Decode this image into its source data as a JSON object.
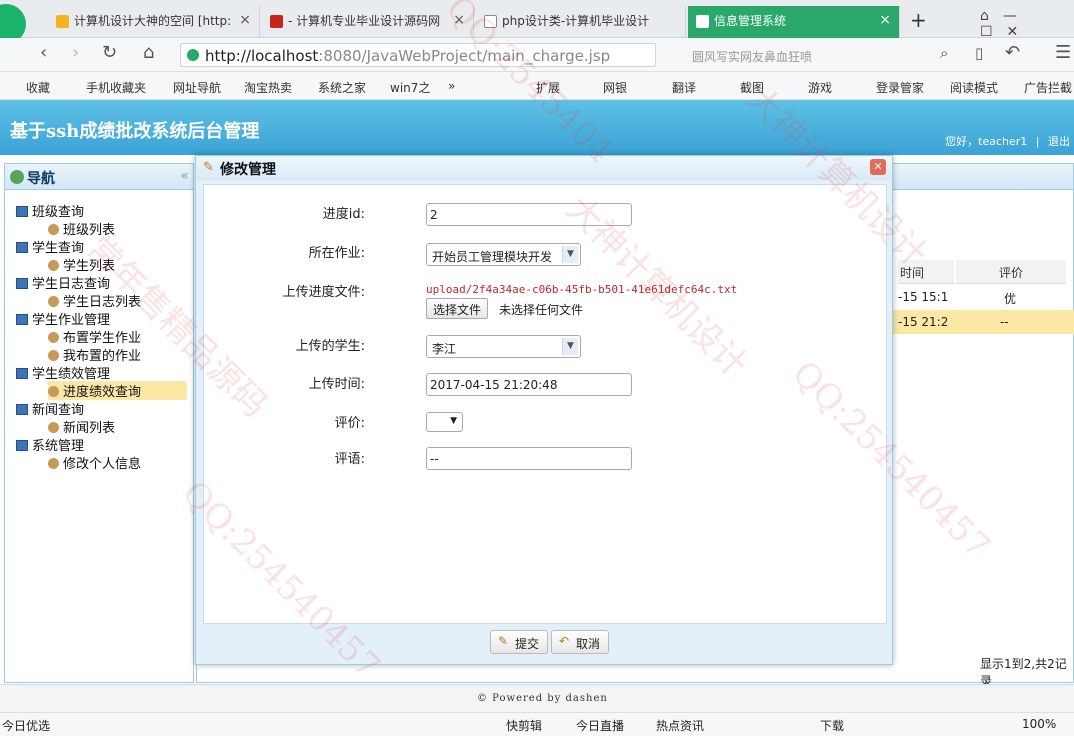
{
  "browser": {
    "tabs": [
      {
        "label": "计算机设计大神的空间 [http:"
      },
      {
        "label": "- 计算机专业毕业设计源码网"
      },
      {
        "label": "php设计类-计算机毕业设计"
      },
      {
        "label": "信息管理系统"
      }
    ],
    "new_tab": "+",
    "url_host": "http://localhost",
    "url_rest": ":8080/JavaWebProject/main_charge.jsp",
    "search_text": "圆风写实网友鼻血狂喷",
    "bookmarks": [
      "收藏",
      "手机收藏夹",
      "网址导航",
      "淘宝热卖",
      "系统之家",
      "win7之",
      "»",
      "扩展",
      "网银",
      "翻译",
      "截图",
      "游戏",
      "登录管家",
      "阅读模式",
      "广告拦截"
    ]
  },
  "app": {
    "title": "基于ssh成绩批改系统后台管理",
    "greeting": "您好，teacher1",
    "sep": "|",
    "logout": "退出",
    "footer": "© Powered by dashen",
    "paging": "显示1到2,共2记录"
  },
  "nav": {
    "title": "导航",
    "collapse": "«",
    "items": [
      {
        "label": "班级查询",
        "level": 0
      },
      {
        "label": "班级列表",
        "level": 1
      },
      {
        "label": "学生查询",
        "level": 0
      },
      {
        "label": "学生列表",
        "level": 1
      },
      {
        "label": "学生日志查询",
        "level": 0
      },
      {
        "label": "学生日志列表",
        "level": 1
      },
      {
        "label": "学生作业管理",
        "level": 0
      },
      {
        "label": "布置学生作业",
        "level": 1
      },
      {
        "label": "我布置的作业",
        "level": 1
      },
      {
        "label": "学生绩效管理",
        "level": 0
      },
      {
        "label": "进度绩效查询",
        "level": 1,
        "selected": true
      },
      {
        "label": "新闻查询",
        "level": 0
      },
      {
        "label": "新闻列表",
        "level": 1
      },
      {
        "label": "系统管理",
        "level": 0
      },
      {
        "label": "修改个人信息",
        "level": 1
      }
    ]
  },
  "grid": {
    "headers": [
      "时间",
      "评价"
    ],
    "rows": [
      [
        "-15 15:1",
        "优"
      ],
      [
        "-15 21:2",
        "--"
      ]
    ]
  },
  "dialog": {
    "title": "修改管理",
    "close": "✕",
    "fields": {
      "id_label": "进度id:",
      "id_value": "2",
      "work_label": "所在作业:",
      "work_value": "开始员工管理模块开发",
      "file_label": "上传进度文件:",
      "file_path": "upload/2f4a34ae-c06b-45fb-b501-41e61defc64c.txt",
      "file_btn": "选择文件",
      "file_none": "未选择任何文件",
      "student_label": "上传的学生:",
      "student_value": "李江",
      "time_label": "上传时间:",
      "time_value": "2017-04-15 21:20:48",
      "eval_label": "评价:",
      "eval_value": "",
      "comment_label": "评语:",
      "comment_value": "--"
    },
    "submit": "提交",
    "cancel": "取消"
  },
  "statusbar": {
    "left": "今日优选",
    "items": [
      "快剪辑",
      "今日直播",
      "热点资讯",
      "下载",
      "100%"
    ]
  },
  "watermark": [
    "QQ:2545404",
    "大神计算机设计",
    "常年售精品源码",
    "QQ:254540457"
  ]
}
